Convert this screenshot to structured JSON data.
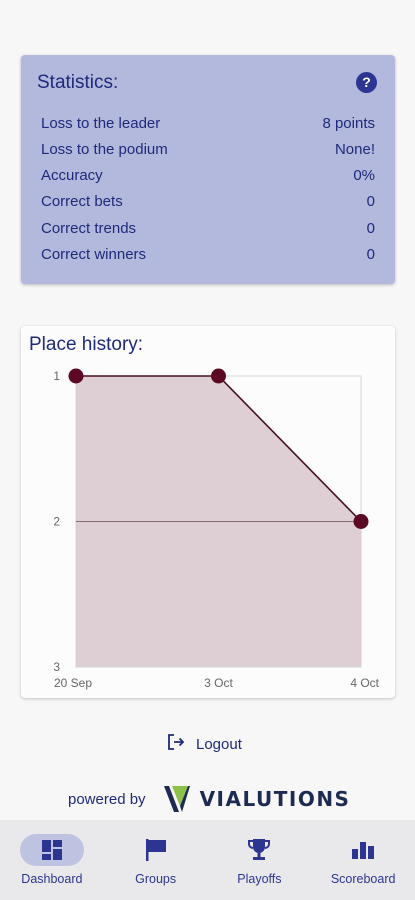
{
  "statistics": {
    "title": "Statistics:",
    "help_icon": "help-circle-icon",
    "rows": [
      {
        "label": "Loss to the leader",
        "value": "8 points"
      },
      {
        "label": "Loss to the podium",
        "value": "None!"
      },
      {
        "label": "Accuracy",
        "value": "0%"
      },
      {
        "label": "Correct bets",
        "value": "0"
      },
      {
        "label": "Correct trends",
        "value": "0"
      },
      {
        "label": "Correct winners",
        "value": "0"
      }
    ]
  },
  "place_history": {
    "title": "Place history:",
    "chart_data": {
      "type": "area",
      "title": "Place history:",
      "x": [
        "20 Sep",
        "3 Oct",
        "4 Oct"
      ],
      "y": [
        1,
        1,
        2
      ],
      "y_ticks": [
        "1",
        "2",
        "3"
      ],
      "ylim": [
        1,
        3
      ],
      "y_inverted": true,
      "grid": true,
      "colors": {
        "line": "#4a0e22",
        "fill": "#d8c7cd",
        "point": "#5c0a24"
      }
    }
  },
  "logout": {
    "label": "Logout",
    "icon": "logout-icon"
  },
  "powered_by": {
    "label": "powered by",
    "brand": "VIALUTIONS"
  },
  "nav": {
    "items": [
      {
        "label": "Dashboard",
        "icon": "dashboard-icon",
        "active": true
      },
      {
        "label": "Groups",
        "icon": "flag-icon",
        "active": false
      },
      {
        "label": "Playoffs",
        "icon": "trophy-icon",
        "active": false
      },
      {
        "label": "Scoreboard",
        "icon": "bar-chart-icon",
        "active": false
      }
    ]
  },
  "colors": {
    "accent": "#2c3590",
    "card": "#b3b8dd",
    "nav_bg": "#e9e9ec"
  }
}
